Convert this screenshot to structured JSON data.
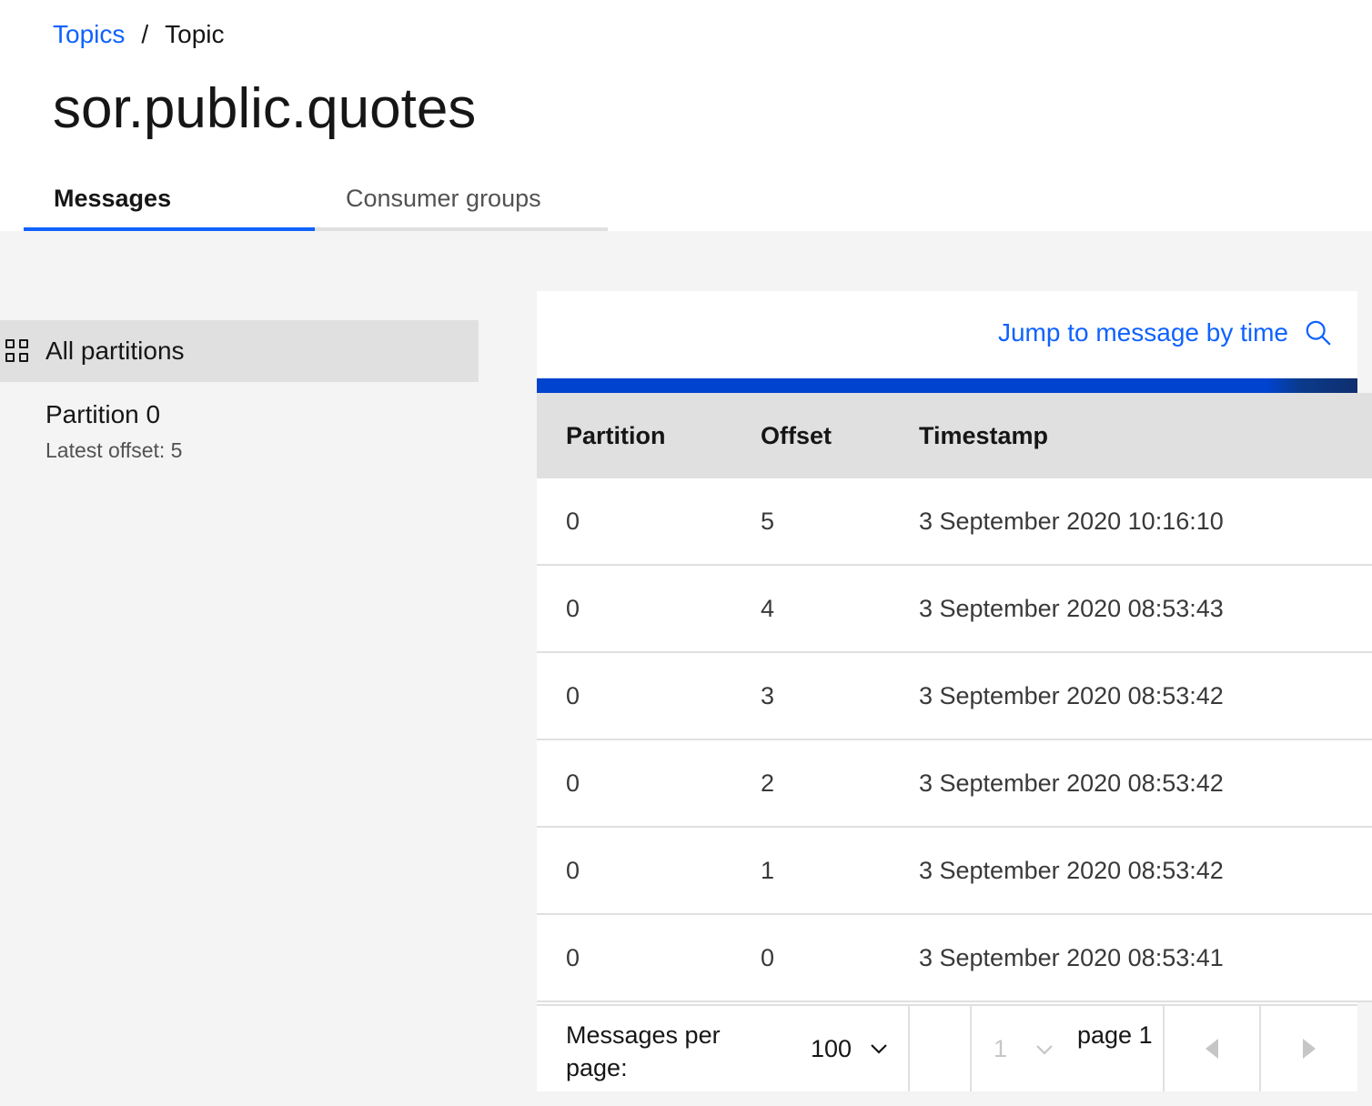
{
  "breadcrumb": {
    "parent": "Topics",
    "separator": "/",
    "current": "Topic"
  },
  "page_title": "sor.public.quotes",
  "tabs": [
    {
      "label": "Messages",
      "active": true
    },
    {
      "label": "Consumer groups",
      "active": false
    }
  ],
  "sidebar": {
    "all_partitions": {
      "label": "All partitions",
      "icon": "grid-icon",
      "selected": true
    },
    "partitions": [
      {
        "label": "Partition 0",
        "sublabel": "Latest offset: 5"
      }
    ]
  },
  "toolbar": {
    "jump_label": "Jump to message by time",
    "icon": "search-icon"
  },
  "table": {
    "headers": {
      "partition": "Partition",
      "offset": "Offset",
      "timestamp": "Timestamp"
    },
    "rows": [
      {
        "partition": "0",
        "offset": "5",
        "timestamp": "3 September 2020 10:16:10"
      },
      {
        "partition": "0",
        "offset": "4",
        "timestamp": "3 September 2020 08:53:43"
      },
      {
        "partition": "0",
        "offset": "3",
        "timestamp": "3 September 2020 08:53:42"
      },
      {
        "partition": "0",
        "offset": "2",
        "timestamp": "3 September 2020 08:53:42"
      },
      {
        "partition": "0",
        "offset": "1",
        "timestamp": "3 September 2020 08:53:42"
      },
      {
        "partition": "0",
        "offset": "0",
        "timestamp": "3 September 2020 08:53:41"
      }
    ]
  },
  "pagination": {
    "per_page_label": "Messages per page:",
    "per_page_value": "100",
    "current_page": "1",
    "page_of_label": "page 1"
  },
  "colors": {
    "accent": "#0f62fe",
    "progress": "#0043ce",
    "header_bg": "#e0e0e0",
    "content_bg": "#f4f4f4"
  }
}
